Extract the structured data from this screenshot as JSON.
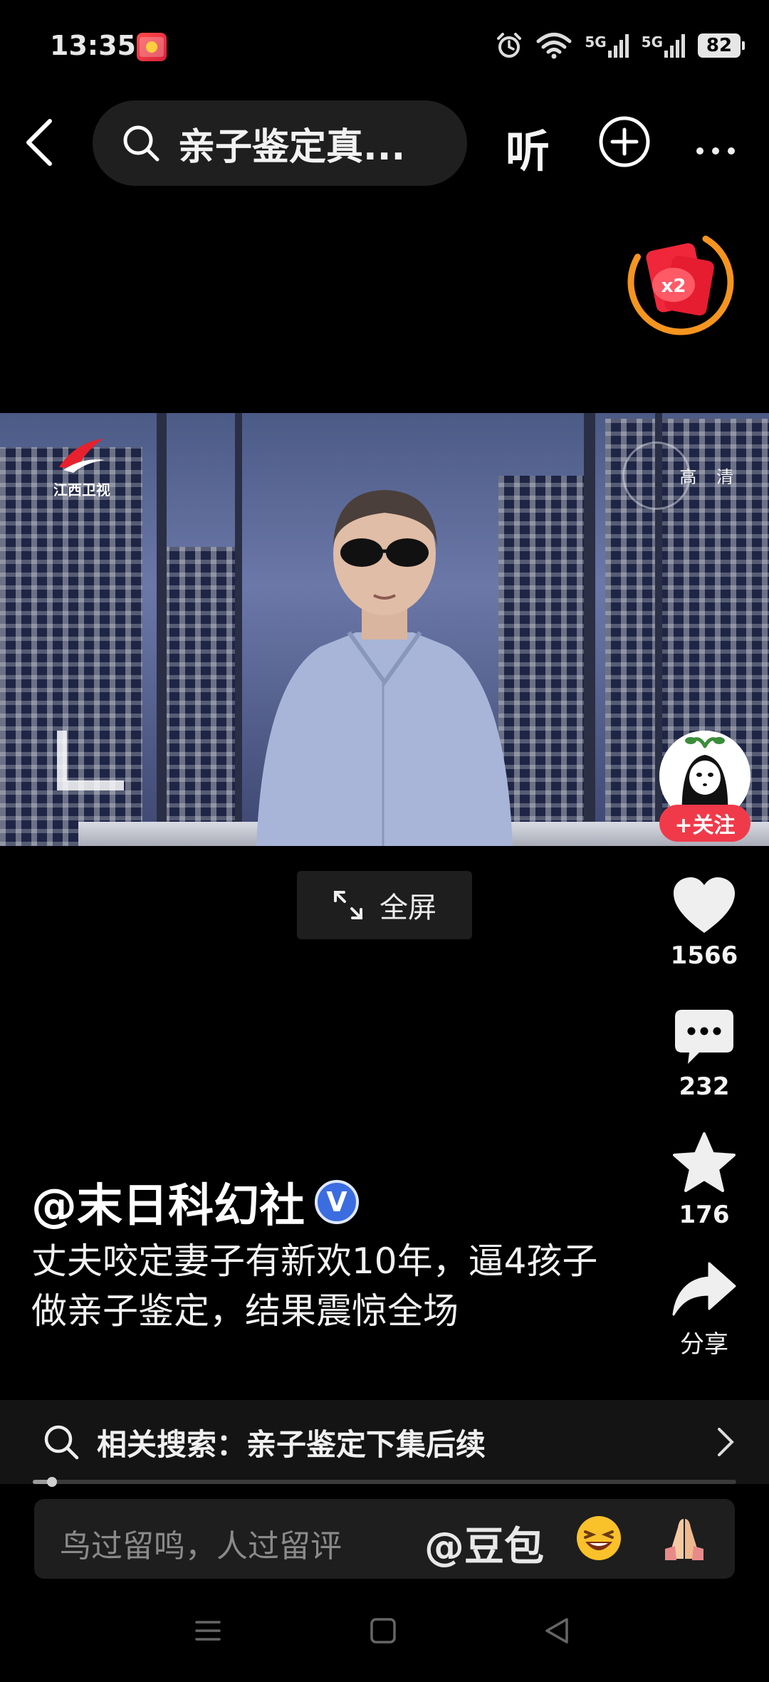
{
  "status_bar": {
    "time": "13:35",
    "battery": "82",
    "network_1": "5G",
    "network_2": "5G",
    "icons": [
      "alarm-icon",
      "wifi-icon",
      "signal-icon",
      "signal-icon",
      "battery-icon"
    ]
  },
  "top_bar": {
    "search_query": "亲子鉴定真...",
    "listen_label": "听"
  },
  "video": {
    "station_name": "江西卫视",
    "quality_label": "高 清"
  },
  "follow": {
    "label": "+关注"
  },
  "fullscreen": {
    "label": "全屏"
  },
  "actions": {
    "likes": "1566",
    "comments": "232",
    "favorites": "176",
    "share_label": "分享"
  },
  "post": {
    "author": "@末日科幻社",
    "verified_mark": "V",
    "caption": "丈夫咬定妻子有新欢10年，逼4孩子做亲子鉴定，结果震惊全场"
  },
  "related_search": {
    "text": "相关搜索：亲子鉴定下集后续"
  },
  "progress": {
    "fraction": 0.027
  },
  "comment_bar": {
    "placeholder": "鸟过留鸣，人过留评",
    "mention": "@豆包"
  },
  "red_packet": {
    "multiplier": "x2",
    "accent": "#f5941f"
  }
}
